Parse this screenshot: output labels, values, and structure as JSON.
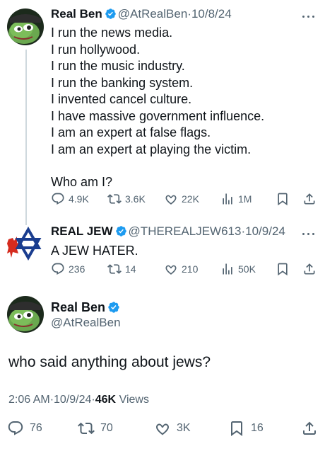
{
  "tweet1": {
    "name": "Real Ben",
    "handle": "@AtRealBen",
    "dot": "·",
    "date": "10/8/24",
    "lines": [
      "I run the news media.",
      "I run hollywood.",
      "I run the music industry.",
      "I run the banking system.",
      "I invented cancel culture.",
      "I have massive government influence.",
      "I am an expert at false flags.",
      "I am an expert at playing the victim."
    ],
    "question": "Who am I?",
    "stats": {
      "replies": "4.9K",
      "reposts": "3.6K",
      "likes": "22K",
      "views": "1M"
    }
  },
  "tweet2": {
    "name": "REAL JEW",
    "handle": "@THEREALJEW613",
    "dot": "·",
    "date": "10/9/24",
    "text": "A JEW HATER.",
    "stats": {
      "replies": "236",
      "reposts": "14",
      "likes": "210",
      "views": "50K"
    }
  },
  "main": {
    "name": "Real Ben",
    "handle": "@AtRealBen",
    "text": "who said anything about jews?",
    "time": "2:06 AM",
    "date": "10/9/24",
    "dot": "·",
    "views_count": "46K",
    "views_label": "Views",
    "stats": {
      "replies": "76",
      "reposts": "70",
      "likes": "3K",
      "bookmarks": "16"
    }
  },
  "colors": {
    "verified": "#1d9bf0",
    "secondary_text": "#536471",
    "primary_text": "#0f1419"
  },
  "icons": [
    "reply-icon",
    "repost-icon",
    "like-icon",
    "views-icon",
    "bookmark-icon",
    "share-icon",
    "verified-badge-icon",
    "more-icon"
  ]
}
